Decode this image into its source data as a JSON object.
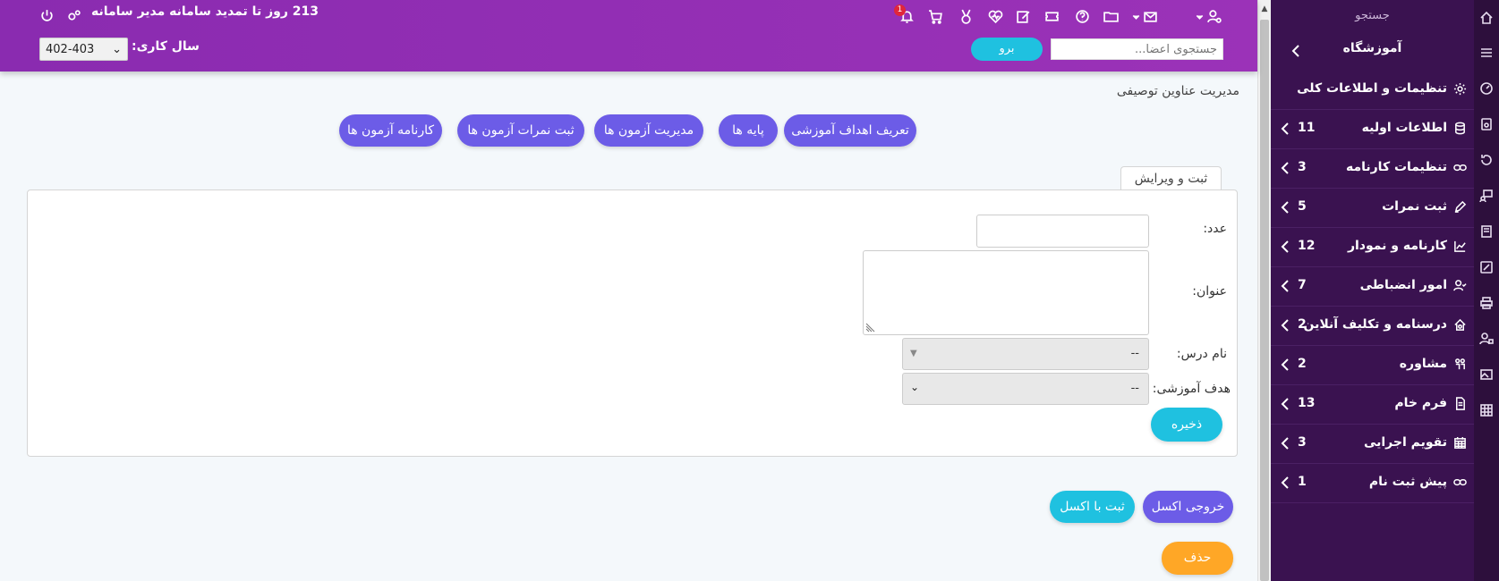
{
  "header": {
    "renew_text": "213 روز تا تمدید سامانه مدیر سامانه",
    "notification_count": "1",
    "year_label": "سال کاری:",
    "year_value": "402-403",
    "go_button": "برو",
    "member_search_placeholder": "جستجوی اعضا..."
  },
  "sidebar": {
    "search_label": "جستجو",
    "school_title": "آموزشگاه",
    "items": [
      {
        "label": "تنظیمات و اطلاعات کلی",
        "count": "",
        "icon": "gear-icon"
      },
      {
        "label": "اطلاعات اولیه",
        "count": "11",
        "icon": "database-icon"
      },
      {
        "label": "تنظیمات کارنامه",
        "count": "3",
        "icon": "link-icon"
      },
      {
        "label": "ثبت نمرات",
        "count": "5",
        "icon": "pen-icon"
      },
      {
        "label": "کارنامه و نمودار",
        "count": "12",
        "icon": "chart-icon"
      },
      {
        "label": "امور انضباطی",
        "count": "7",
        "icon": "user-check-icon"
      },
      {
        "label": "درسنامه و تکلیف آنلاین",
        "count": "2",
        "icon": "house-gear-icon"
      },
      {
        "label": "مشاوره",
        "count": "2",
        "icon": "people-icon"
      },
      {
        "label": "فرم خام",
        "count": "13",
        "icon": "form-icon"
      },
      {
        "label": "تقویم اجرایی",
        "count": "3",
        "icon": "calendar-icon"
      },
      {
        "label": "پیش ثبت نام",
        "count": "1",
        "icon": "link-icon"
      }
    ]
  },
  "main": {
    "page_title": "مدیریت عناوین توصیفی",
    "nav_buttons": [
      "تعریف اهداف آموزشی",
      "پایه ها",
      "مدیریت آزمون ها",
      "ثبت نمرات آزمون ها",
      "کارنامه آزمون ها"
    ],
    "tab_label": "ثبت و ویرایش",
    "form": {
      "number_label": "عدد:",
      "number_value": "",
      "title_label": "عنوان:",
      "title_value": "",
      "lesson_label": "نام درس:",
      "lesson_value": "--",
      "goal_label": "هدف آموزشی:",
      "goal_value": "--",
      "save_button": "ذخیره"
    },
    "excel_export_button": "خروجی اکسل",
    "excel_import_button": "ثبت با اکسل",
    "delete_button": "حذف"
  },
  "colors": {
    "header_purple": "#9b32b8",
    "sidebar_bg": "#3a1250",
    "primary_pill": "#6c5ce7",
    "cyan": "#1fc1e0",
    "orange": "#ffa726"
  }
}
